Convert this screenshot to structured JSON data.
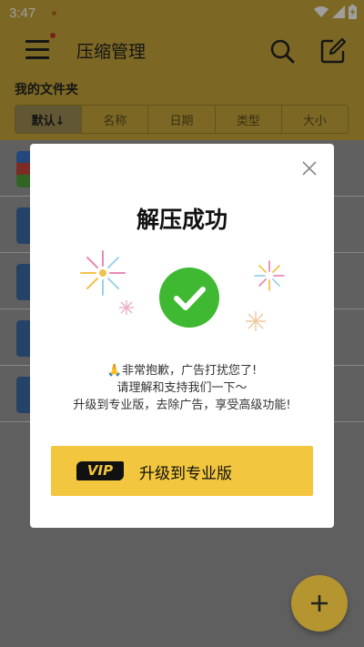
{
  "status_bar": {
    "time": "3:47"
  },
  "app_bar": {
    "title": "压缩管理"
  },
  "folder_header": {
    "label": "我的文件夹"
  },
  "sort_options": [
    {
      "label": "默认↓"
    },
    {
      "label": "名称"
    },
    {
      "label": "日期"
    },
    {
      "label": "类型"
    },
    {
      "label": "大小"
    }
  ],
  "dialog": {
    "title": "解压成功",
    "message_lines": [
      "🙏非常抱歉，广告打扰您了!",
      "请理解和支持我们一下～",
      "升级到专业版，去除广告，享受高级功能!"
    ],
    "vip_badge": "VIP",
    "upgrade_label": "升级到专业版"
  },
  "fab": {
    "icon": "plus-icon"
  },
  "colors": {
    "appbar": "#c9a83a",
    "accent": "#f2c63e",
    "success": "#3fb832"
  }
}
